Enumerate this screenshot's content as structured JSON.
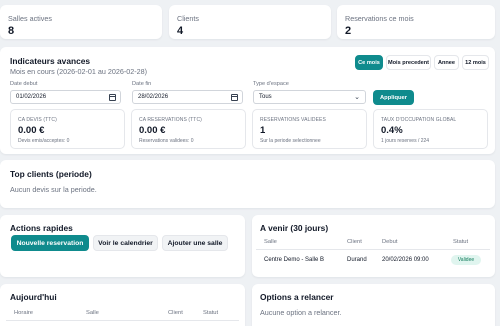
{
  "stats": [
    {
      "label": "Salles actives",
      "value": "8"
    },
    {
      "label": "Clients",
      "value": "4"
    },
    {
      "label": "Reservations ce mois",
      "value": "2"
    }
  ],
  "indicators": {
    "title": "Indicateurs avances",
    "subtitle": "Mois en cours (2026-02-01 au 2026-02-28)",
    "periods": [
      {
        "label": "Ce mois",
        "active": true
      },
      {
        "label": "Mois precedent",
        "active": false
      },
      {
        "label": "Annee",
        "active": false
      },
      {
        "label": "12 mois",
        "active": false
      }
    ],
    "date_start_label": "Date debut",
    "date_start_value": "01/02/2026",
    "date_end_label": "Date fin",
    "date_end_value": "28/02/2026",
    "space_type_label": "Type d'espace",
    "space_type_value": "Tous",
    "apply_label": "Appliquer",
    "kpis": [
      {
        "label": "CA DEVIS (TTC)",
        "value": "0.00 €",
        "sub": "Devis emis/acceptes: 0"
      },
      {
        "label": "CA RESERVATIONS (TTC)",
        "value": "0.00 €",
        "sub": "Reservations validees: 0"
      },
      {
        "label": "RESERVATIONS VALIDEES",
        "value": "1",
        "sub": "Sur la periode selectionnee"
      },
      {
        "label": "TAUX D'OCCUPATION GLOBAL",
        "value": "0.4%",
        "sub": "1 jours reserves / 224"
      }
    ]
  },
  "top_clients": {
    "title": "Top clients (periode)",
    "empty": "Aucun devis sur la periode."
  },
  "quick_actions": {
    "title": "Actions rapides",
    "new_reservation": "Nouvelle reservation",
    "view_calendar": "Voir le calendrier",
    "add_room": "Ajouter une salle"
  },
  "upcoming": {
    "title": "A venir (30 jours)",
    "headers": [
      "Salle",
      "Client",
      "Debut",
      "Statut"
    ],
    "rows": [
      {
        "salle": "Centre Demo - Salle B",
        "client": "Durand",
        "debut": "20/02/2026 09:00",
        "statut": "Validee"
      }
    ]
  },
  "today": {
    "title": "Aujourd'hui",
    "headers": [
      "Horaire",
      "Salle",
      "Client",
      "Statut"
    ]
  },
  "follow_up": {
    "title": "Options a relancer",
    "empty": "Aucune option a relancer."
  },
  "colors": {
    "accent": "#0f8b8d",
    "background": "#eef1f4",
    "success_badge": "#e0f5ef"
  }
}
